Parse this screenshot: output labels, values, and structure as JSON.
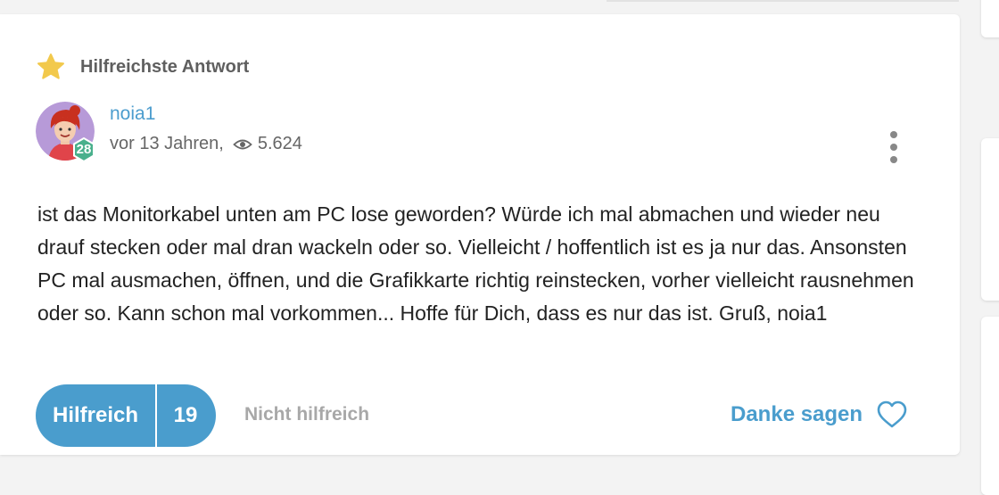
{
  "badge": {
    "label": "Hilfreichste Antwort",
    "icon": "star-icon",
    "color": "#f2c94c"
  },
  "author": {
    "name": "noia1",
    "level": "28",
    "time": "vor 13 Jahren,",
    "views": "5.624",
    "avatar_icon": "avatar-icon",
    "level_color": "#49b08c"
  },
  "body": {
    "text": "ist das Monitorkabel unten am PC lose geworden? Würde ich mal abmachen und wieder neu drauf stecken oder mal dran wackeln oder so. Vielleicht / hoffentlich ist es ja nur das. Ansonsten PC mal ausmachen, öffnen, und die Grafikkarte richtig reinstecken, vorher vielleicht rausnehmen oder so. Kann schon mal vorkommen... Hoffe für Dich, dass es nur das ist. Gruß, noia1"
  },
  "actions": {
    "helpful_label": "Hilfreich",
    "helpful_count": "19",
    "not_helpful_label": "Nicht hilfreich",
    "thanks_label": "Danke sagen",
    "accent": "#4a9dcd"
  }
}
